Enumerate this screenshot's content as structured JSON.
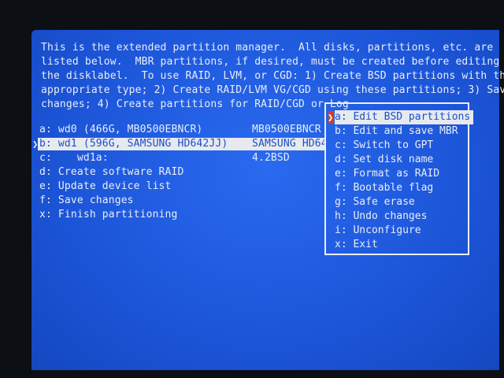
{
  "intro": {
    "lines": [
      "This is the extended partition manager.  All disks, partitions, etc. are",
      "listed below.  MBR partitions, if desired, must be created before editing",
      "the disklabel.  To use RAID, LVM, or CGD: 1) Create BSD partitions with the",
      "appropriate type; 2) Create RAID/LVM VG/CGD using these partitions; 3) Save",
      "changes; 4) Create partitions for RAID/CGD or Log"
    ]
  },
  "entries": [
    {
      "label": "a: wd0 (466G, MB0500EBNCR)",
      "type": "MB0500EBNCR",
      "selected": false
    },
    {
      "label": "b: wd1 (596G, SAMSUNG HD642JJ)",
      "type": "SAMSUNG HD64",
      "selected": true
    },
    {
      "label": "c:    wd1a:",
      "type": "4.2BSD",
      "selected": false
    },
    {
      "label": "d: Create software RAID",
      "type": "",
      "selected": false
    },
    {
      "label": "e: Update device list",
      "type": "",
      "selected": false
    },
    {
      "label": "f: Save changes",
      "type": "",
      "selected": false
    },
    {
      "label": "x: Finish partitioning",
      "type": "",
      "selected": false
    }
  ],
  "menu": {
    "items": [
      {
        "label": "a: Edit BSD partitions",
        "active": true
      },
      {
        "label": "b: Edit and save MBR",
        "active": false
      },
      {
        "label": "c: Switch to GPT",
        "active": false
      },
      {
        "label": "d: Set disk name",
        "active": false
      },
      {
        "label": "e: Format as RAID",
        "active": false
      },
      {
        "label": "f: Bootable flag",
        "active": false
      },
      {
        "label": "g: Safe erase",
        "active": false
      },
      {
        "label": "h: Undo changes",
        "active": false
      },
      {
        "label": "i: Unconfigure",
        "active": false
      },
      {
        "label": "x: Exit",
        "active": false
      }
    ]
  },
  "colors": {
    "screen_bg": "#1e5be0",
    "text": "#e9eef8",
    "highlight_bg": "#e6e9ee",
    "highlight_text": "#1c4fc4",
    "cursor": "#d04028"
  }
}
